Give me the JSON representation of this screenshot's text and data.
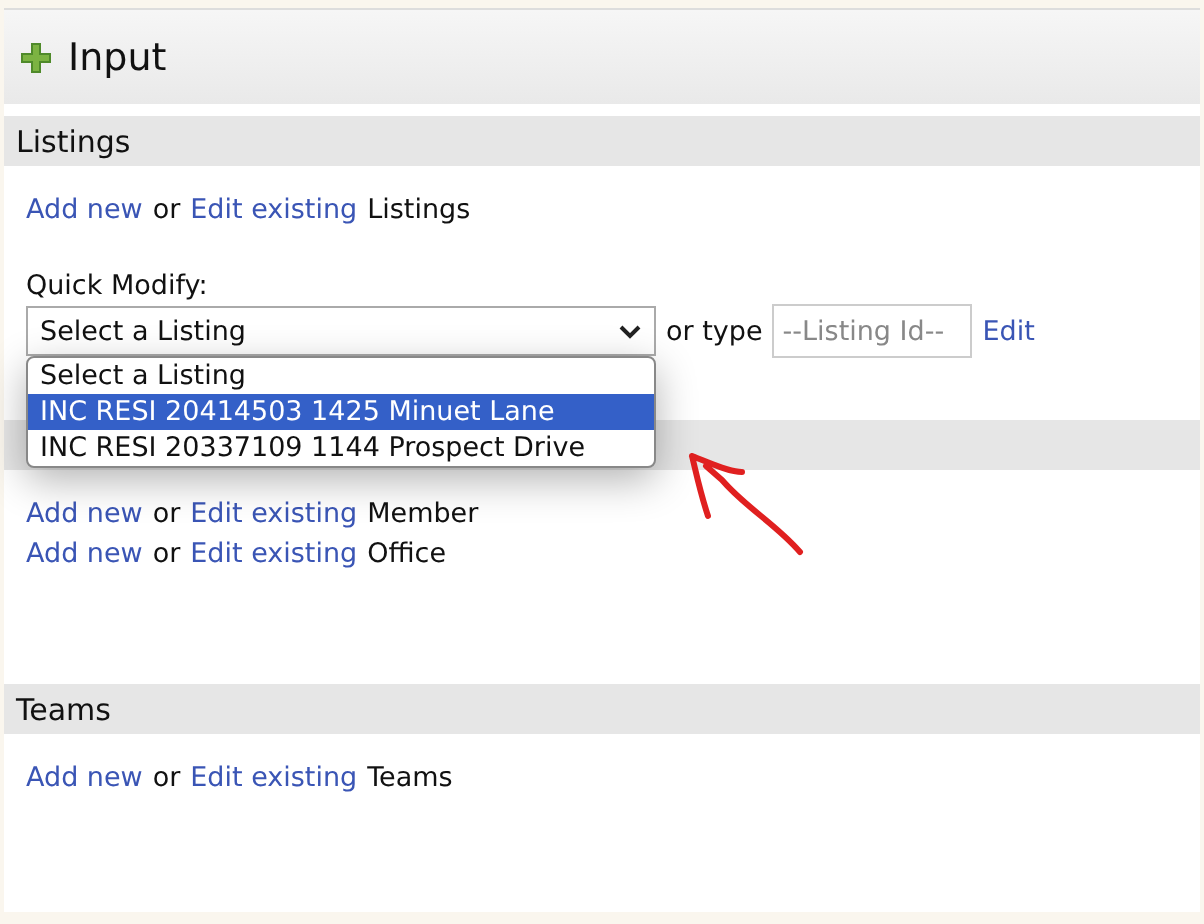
{
  "title": "Input",
  "sections": [
    {
      "heading": "Listings",
      "lines": [
        {
          "add": "Add new",
          "or": "or",
          "edit": "Edit existing",
          "target": "Listings"
        }
      ],
      "quick_modify": {
        "label": "Quick Modify:",
        "select_value": "Select a Listing",
        "expanded": true,
        "options": [
          {
            "label": "Select a Listing",
            "selected": false
          },
          {
            "label": "INC RESI 20414503 1425 Minuet Lane",
            "selected": true
          },
          {
            "label": "INC RESI 20337109 1144 Prospect Drive",
            "selected": false
          }
        ],
        "or_type": "or type",
        "id_placeholder": "--Listing Id--",
        "edit": "Edit"
      }
    },
    {
      "lines": [
        {
          "add": "Add new",
          "or": "or",
          "edit": "Edit existing",
          "target": "Member"
        },
        {
          "add": "Add new",
          "or": "or",
          "edit": "Edit existing",
          "target": "Office"
        }
      ]
    },
    {
      "heading": "Teams",
      "lines": [
        {
          "add": "Add new",
          "or": "or",
          "edit": "Edit existing",
          "target": "Teams"
        }
      ]
    }
  ]
}
